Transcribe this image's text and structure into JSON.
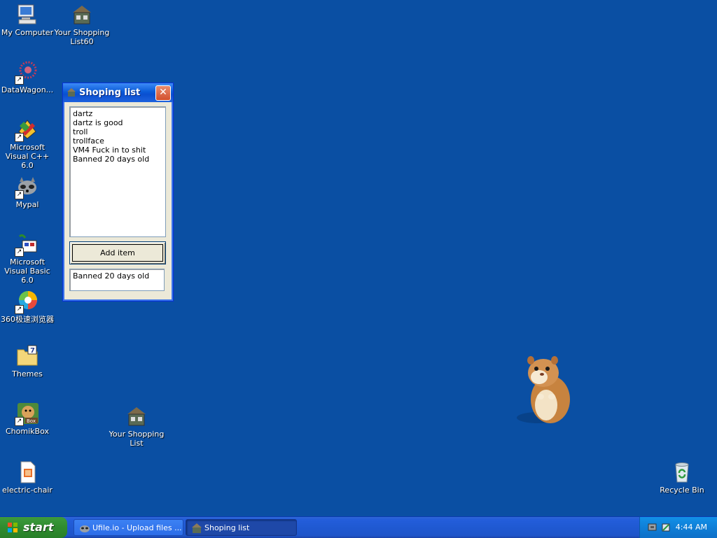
{
  "desktop": {
    "icons": [
      {
        "label": "My Computer",
        "icon": "computer-icon"
      },
      {
        "label": "Your Shopping List60",
        "icon": "shopping-list-icon"
      },
      {
        "label": "DataWagon...",
        "icon": "datawagon-icon"
      },
      {
        "label": "Microsoft Visual C++ 6.0",
        "icon": "visual-cpp-icon"
      },
      {
        "label": "Mypal",
        "icon": "raccoon-icon"
      },
      {
        "label": "Microsoft Visual Basic 6.0",
        "icon": "visual-basic-icon"
      },
      {
        "label": "360极速浏览器",
        "icon": "browser-360-icon"
      },
      {
        "label": "Themes",
        "icon": "folder-icon"
      },
      {
        "label": "ChomikBox",
        "icon": "hamster-box-icon"
      },
      {
        "label": "Your Shopping List",
        "icon": "shopping-list-icon"
      },
      {
        "label": "electric-chair",
        "icon": "document-icon"
      },
      {
        "label": "Recycle Bin",
        "icon": "recycle-bin-icon"
      }
    ],
    "background_color": "#0a4fa3"
  },
  "window": {
    "title": "Shoping list",
    "list_items": [
      "dartz",
      "dartz is good",
      "troll",
      "trollface",
      "VM4 Fuck in to shit",
      "Banned 20 days old"
    ],
    "add_button_label": "Add item",
    "input_value": "Banned 20 days old"
  },
  "taskbar": {
    "start_label": "start",
    "tasks": [
      {
        "label": "Ufile.io - Upload files ...",
        "icon": "raccoon-icon"
      },
      {
        "label": "Shoping list",
        "icon": "shopping-list-icon"
      }
    ],
    "clock": "4:44 AM"
  }
}
